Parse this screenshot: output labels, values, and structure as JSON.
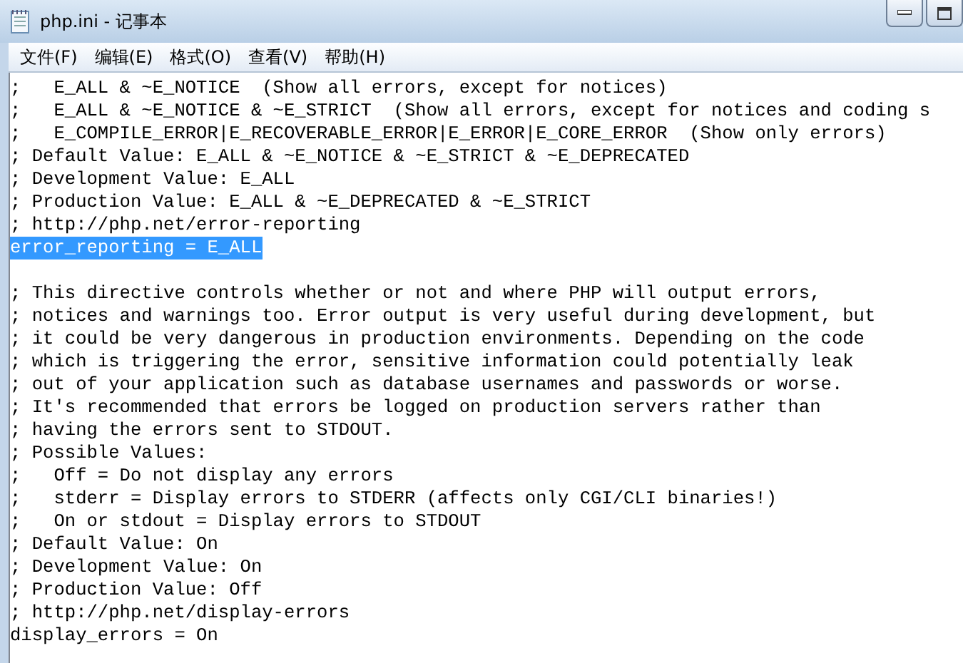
{
  "window": {
    "title": "php.ini - 记事本"
  },
  "menu": [
    {
      "label": "文件(F)"
    },
    {
      "label": "编辑(E)"
    },
    {
      "label": "格式(O)"
    },
    {
      "label": "查看(V)"
    },
    {
      "label": "帮助(H)"
    }
  ],
  "lines": [
    {
      "kind": "text",
      "text": ";   E_ALL & ~E_NOTICE  (Show all errors, except for notices)",
      "selected": false
    },
    {
      "kind": "text",
      "text": ";   E_ALL & ~E_NOTICE & ~E_STRICT  (Show all errors, except for notices and coding s",
      "selected": false
    },
    {
      "kind": "text",
      "text": ";   E_COMPILE_ERROR|E_RECOVERABLE_ERROR|E_ERROR|E_CORE_ERROR  (Show only errors)",
      "selected": false
    },
    {
      "kind": "text",
      "text": "; Default Value: E_ALL & ~E_NOTICE & ~E_STRICT & ~E_DEPRECATED",
      "selected": false
    },
    {
      "kind": "text",
      "text": "; Development Value: E_ALL",
      "selected": false
    },
    {
      "kind": "text",
      "text": "; Production Value: E_ALL & ~E_DEPRECATED & ~E_STRICT",
      "selected": false
    },
    {
      "kind": "text",
      "text": "; http://php.net/error-reporting",
      "selected": false
    },
    {
      "kind": "text",
      "text": "error_reporting = E_ALL",
      "selected": true
    },
    {
      "kind": "blank"
    },
    {
      "kind": "text",
      "text": "; This directive controls whether or not and where PHP will output errors,",
      "selected": false
    },
    {
      "kind": "text",
      "text": "; notices and warnings too. Error output is very useful during development, but",
      "selected": false
    },
    {
      "kind": "text",
      "text": "; it could be very dangerous in production environments. Depending on the code",
      "selected": false
    },
    {
      "kind": "text",
      "text": "; which is triggering the error, sensitive information could potentially leak",
      "selected": false
    },
    {
      "kind": "text",
      "text": "; out of your application such as database usernames and passwords or worse.",
      "selected": false
    },
    {
      "kind": "text",
      "text": "; It's recommended that errors be logged on production servers rather than",
      "selected": false
    },
    {
      "kind": "text",
      "text": "; having the errors sent to STDOUT.",
      "selected": false
    },
    {
      "kind": "text",
      "text": "; Possible Values:",
      "selected": false
    },
    {
      "kind": "text",
      "text": ";   Off = Do not display any errors",
      "selected": false
    },
    {
      "kind": "text",
      "text": ";   stderr = Display errors to STDERR (affects only CGI/CLI binaries!)",
      "selected": false
    },
    {
      "kind": "text",
      "text": ";   On or stdout = Display errors to STDOUT",
      "selected": false
    },
    {
      "kind": "text",
      "text": "; Default Value: On",
      "selected": false
    },
    {
      "kind": "text",
      "text": "; Development Value: On",
      "selected": false
    },
    {
      "kind": "text",
      "text": "; Production Value: Off",
      "selected": false
    },
    {
      "kind": "text",
      "text": "; http://php.net/display-errors",
      "selected": false
    },
    {
      "kind": "text",
      "text": "display_errors = On",
      "selected": false
    }
  ]
}
